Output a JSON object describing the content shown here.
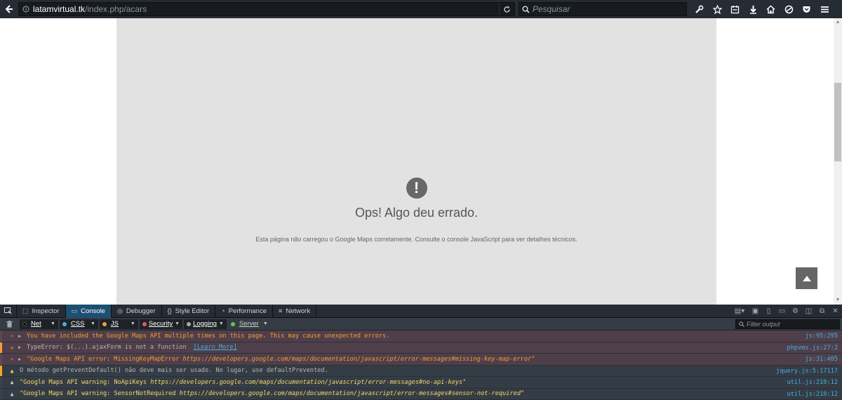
{
  "browser": {
    "url_host": "latamvirtual.tk",
    "url_path": "/index.php/acars",
    "search_placeholder": "Pesquisar"
  },
  "map_error": {
    "icon": "!",
    "title": "Ops! Algo deu errado.",
    "message": "Esta página não carregou o Google Maps corretamente. Consulte o console JavaScript para ver detalhes técnicos."
  },
  "devtools": {
    "tabs": [
      {
        "label": "Inspector",
        "icon": "inspector-icon"
      },
      {
        "label": "Console",
        "icon": "console-icon",
        "active": true
      },
      {
        "label": "Debugger",
        "icon": "debugger-icon"
      },
      {
        "label": "Style Editor",
        "icon": "style-editor-icon"
      },
      {
        "label": "Performance",
        "icon": "performance-icon"
      },
      {
        "label": "Network",
        "icon": "network-icon"
      }
    ],
    "filters": [
      {
        "label": "Net",
        "color": "#0b0b0b"
      },
      {
        "label": "CSS",
        "color": "#46afe3"
      },
      {
        "label": "JS",
        "color": "#f89b37"
      },
      {
        "label": "Security",
        "color": "#eb5368"
      },
      {
        "label": "Logging",
        "color": "#aaaaaa"
      },
      {
        "label": "Server",
        "color": "#70bf53"
      }
    ],
    "filter_placeholder": "Filter output",
    "log": [
      {
        "type": "error",
        "message": "You have included the Google Maps API multiple times on this page. This may cause unexpected errors.",
        "source": "js",
        "line": ":95:295",
        "color": "#f89b37"
      },
      {
        "type": "error",
        "message": "TypeError: $(...).ajaxForm is not a function",
        "link": "[Learn More]",
        "source": "phpvms.js",
        "line": ":27:2",
        "color": "#b5b5b5"
      },
      {
        "type": "error",
        "message": "\"Google Maps API error: MissingKeyMapError ",
        "italic": "https://developers.google.com/maps/documentation/javascript/error-messages#missing-key-map-error",
        "close": "\"",
        "source": "js",
        "line": ":31:405",
        "color": "#f89b37"
      },
      {
        "type": "warn",
        "message": "O método getPreventDefault() não deve mais ser usado. No lugar, use defaultPrevented.",
        "source": "jquery.js",
        "line": ":5:17117",
        "color": "#b5b5b5"
      },
      {
        "type": "warn",
        "message": "\"Google Maps API warning: NoApiKeys ",
        "italic": "https://developers.google.com/maps/documentation/javascript/error-messages#no-api-keys",
        "close": "\"",
        "source": "util.js",
        "line": ":210:12",
        "color": "#f5d96c"
      },
      {
        "type": "warn",
        "message": "\"Google Maps API warning: SensorNotRequired ",
        "italic": "https://developers.google.com/maps/documentation/javascript/error-messages#sensor-not-required",
        "close": "\"",
        "source": "util.js",
        "line": ":210:12",
        "color": "#f5d96c"
      }
    ]
  }
}
